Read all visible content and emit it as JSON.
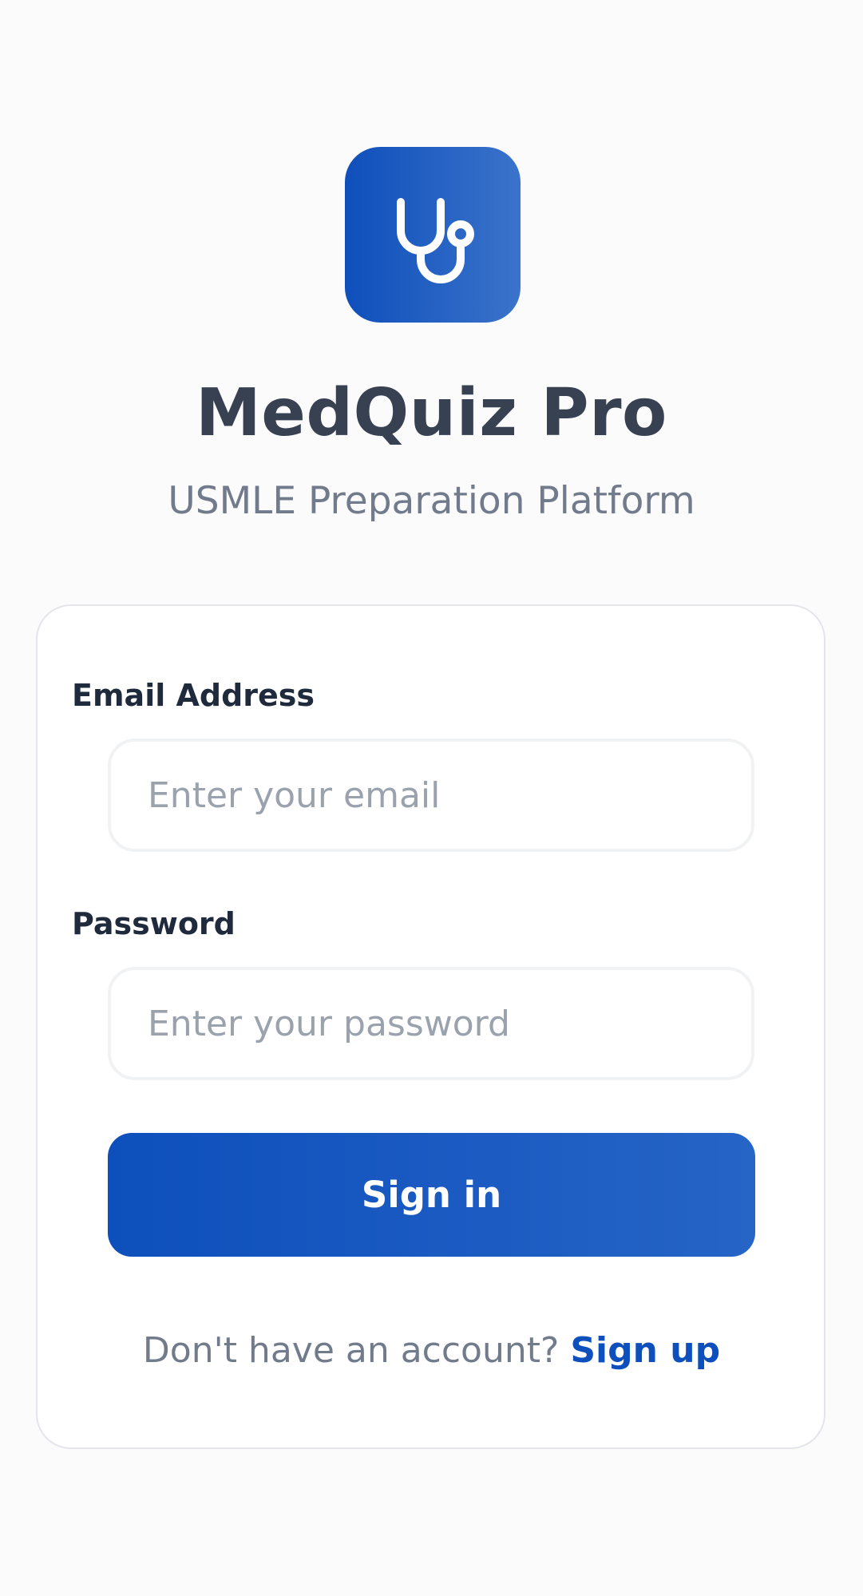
{
  "brand": {
    "logo_icon": "stethoscope-icon",
    "title": "MedQuiz Pro",
    "subtitle": "USMLE Preparation Platform"
  },
  "login_form": {
    "email": {
      "label": "Email Address",
      "placeholder": "Enter your email",
      "value": ""
    },
    "password": {
      "label": "Password",
      "placeholder": "Enter your password",
      "value": ""
    },
    "submit_label": "Sign in",
    "signup_prompt": "Don't have an account?",
    "signup_link": "Sign up"
  },
  "colors": {
    "accent": "#0d4fbc",
    "title_text": "#374151",
    "muted_text": "#717b8c",
    "label_text": "#1f2a3c",
    "placeholder_text": "#9aa2ae"
  }
}
